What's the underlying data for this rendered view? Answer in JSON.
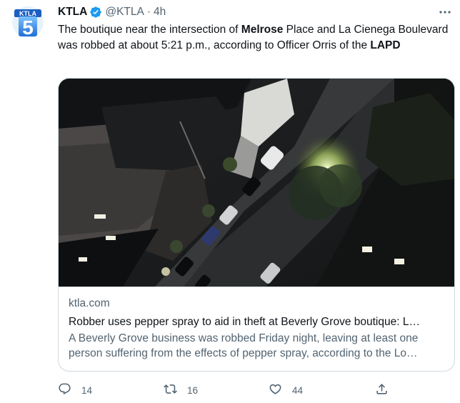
{
  "account": {
    "avatar_text_top": "KTLA",
    "avatar_text_big": "5",
    "name": "KTLA",
    "handle": "@KTLA",
    "separator": "·",
    "time": "4h"
  },
  "tweet": {
    "segments": [
      {
        "text": "The boutique near the intersection of ",
        "bold": false
      },
      {
        "text": "Melrose",
        "bold": true
      },
      {
        "text": " Place and La Cienega Boulevard was robbed at about 5:21 p.m., according to Officer Orris of the ",
        "bold": false
      },
      {
        "text": "LAPD",
        "bold": true
      }
    ]
  },
  "card": {
    "domain": "ktla.com",
    "title": "Robber uses pepper spray to aid in theft at Beverly Grove boutique: L…",
    "description": "A Beverly Grove business was robbed Friday night, leaving at least one person suffering from the effects of pepper spray, according to the Lo…"
  },
  "actions": {
    "replies": "14",
    "retweets": "16",
    "likes": "44"
  },
  "colors": {
    "text": "#0f1419",
    "secondary": "#536471",
    "verified": "#1d9bf0",
    "border": "#cfd9de"
  }
}
